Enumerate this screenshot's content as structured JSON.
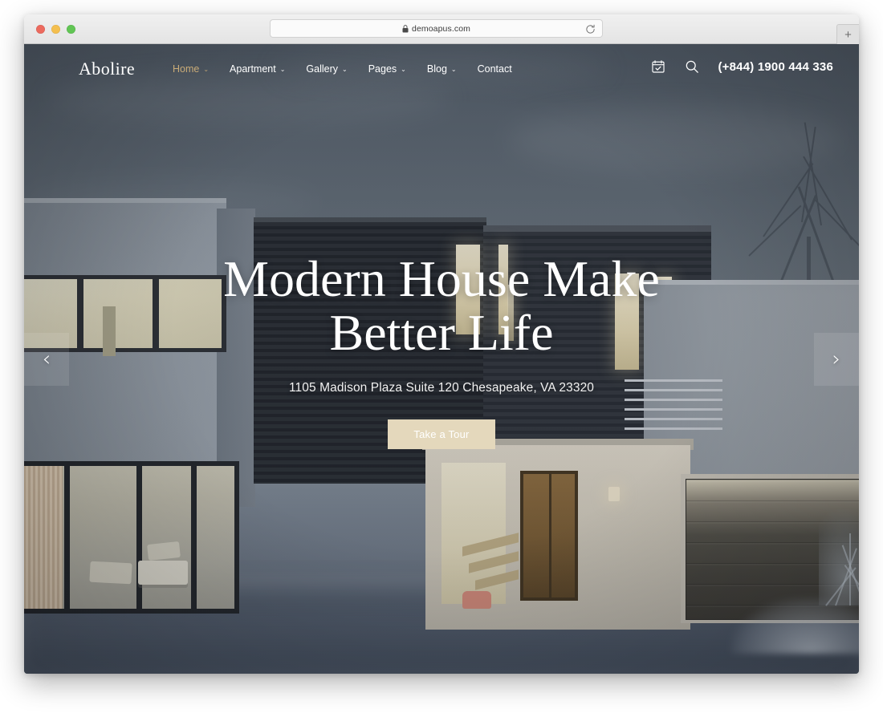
{
  "browser": {
    "url": "demoapus.com",
    "lock_icon": "lock-icon",
    "reload_icon": "reload-icon",
    "new_tab_label": "+",
    "traffic_lights": [
      "close",
      "minimize",
      "maximize"
    ]
  },
  "site": {
    "logo": "Abolire",
    "nav": [
      {
        "label": "Home",
        "has_dropdown": true,
        "active": true
      },
      {
        "label": "Apartment",
        "has_dropdown": true,
        "active": false
      },
      {
        "label": "Gallery",
        "has_dropdown": true,
        "active": false
      },
      {
        "label": "Pages",
        "has_dropdown": true,
        "active": false
      },
      {
        "label": "Blog",
        "has_dropdown": true,
        "active": false
      },
      {
        "label": "Contact",
        "has_dropdown": false,
        "active": false
      }
    ],
    "caret": "⌄",
    "header_icons": [
      "calendar-check-icon",
      "search-icon"
    ],
    "phone": "(+844) 1900 444 336"
  },
  "hero": {
    "title_line1": "Modern House Make",
    "title_line2": "Better Life",
    "subtitle": "1105 Madison Plaza Suite 120 Chesapeake, VA 23320",
    "cta_label": "Take a Tour",
    "prev_arrow": "‹",
    "next_arrow": "›"
  },
  "colors": {
    "accent_gold": "#c9ab77",
    "cta_background": "#e4d8bc",
    "hero_text": "#ffffff",
    "sky": "#5d6872"
  }
}
